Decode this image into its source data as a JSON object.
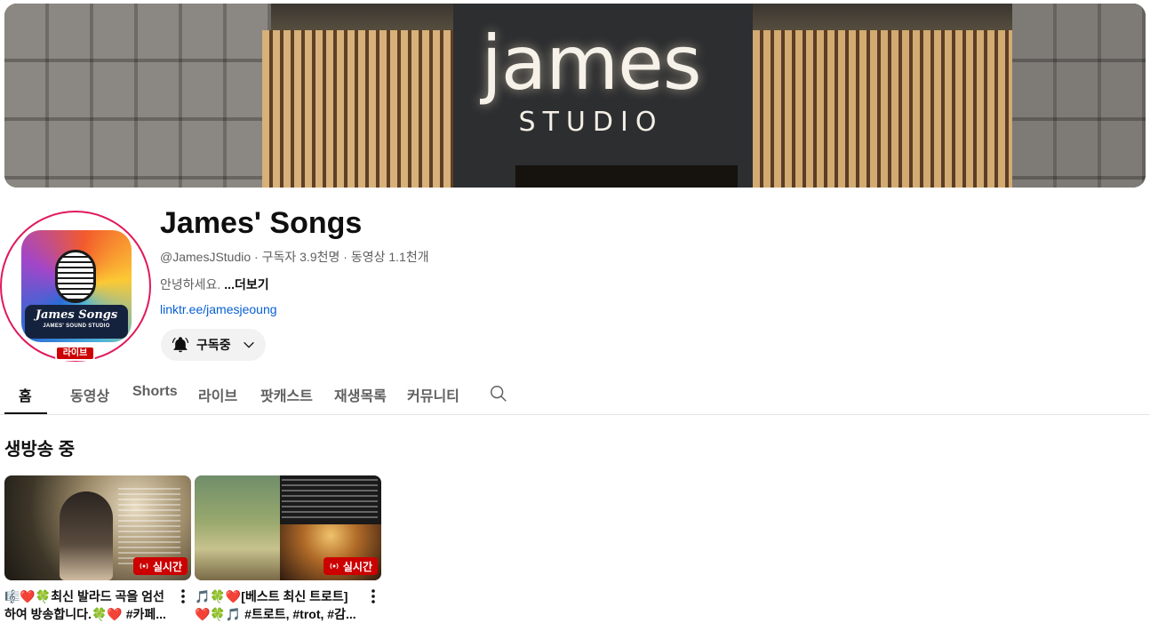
{
  "banner": {
    "logo_main": "james",
    "logo_sub": "STUDIO"
  },
  "channel": {
    "name": "James' Songs",
    "handle": "@JamesJStudio",
    "subscribers": "구독자 3.9천명",
    "videos": "동영상 1.1천개",
    "meta_separator": " · ",
    "description": "안녕하세요.",
    "more_label": "...더보기",
    "link": "linktr.ee/jamesjeoung",
    "live_badge": "라이브",
    "avatar_title": "James Songs",
    "avatar_subtitle": "JAMES' SOUND STUDIO"
  },
  "subscribe_button": {
    "label": "구독중"
  },
  "tabs": [
    {
      "label": "홈",
      "active": true
    },
    {
      "label": "동영상",
      "active": false
    },
    {
      "label": "Shorts",
      "active": false
    },
    {
      "label": "라이브",
      "active": false
    },
    {
      "label": "팟캐스트",
      "active": false
    },
    {
      "label": "재생목록",
      "active": false
    },
    {
      "label": "커뮤니티",
      "active": false
    }
  ],
  "section": {
    "title": "생방송 중"
  },
  "videos": [
    {
      "title": "🎼❤️🍀최신 발라드 곡을 엄선하여 방송합니다.🍀❤️ #카페...",
      "live_label": "실시간"
    },
    {
      "title": "🎵🍀❤️[베스트 최신 트로트] ❤️🍀🎵 #트로트, #trot, #감...",
      "live_label": "실시간"
    }
  ],
  "icons": {
    "bell": "bell-icon",
    "chevron": "chevron-down-icon",
    "search": "search-icon",
    "kebab": "more-vert-icon",
    "live": "live-broadcast-icon"
  },
  "colors": {
    "live_red": "#cc0000",
    "link_blue": "#065fd4",
    "avatar_ring": "#e0195a"
  }
}
